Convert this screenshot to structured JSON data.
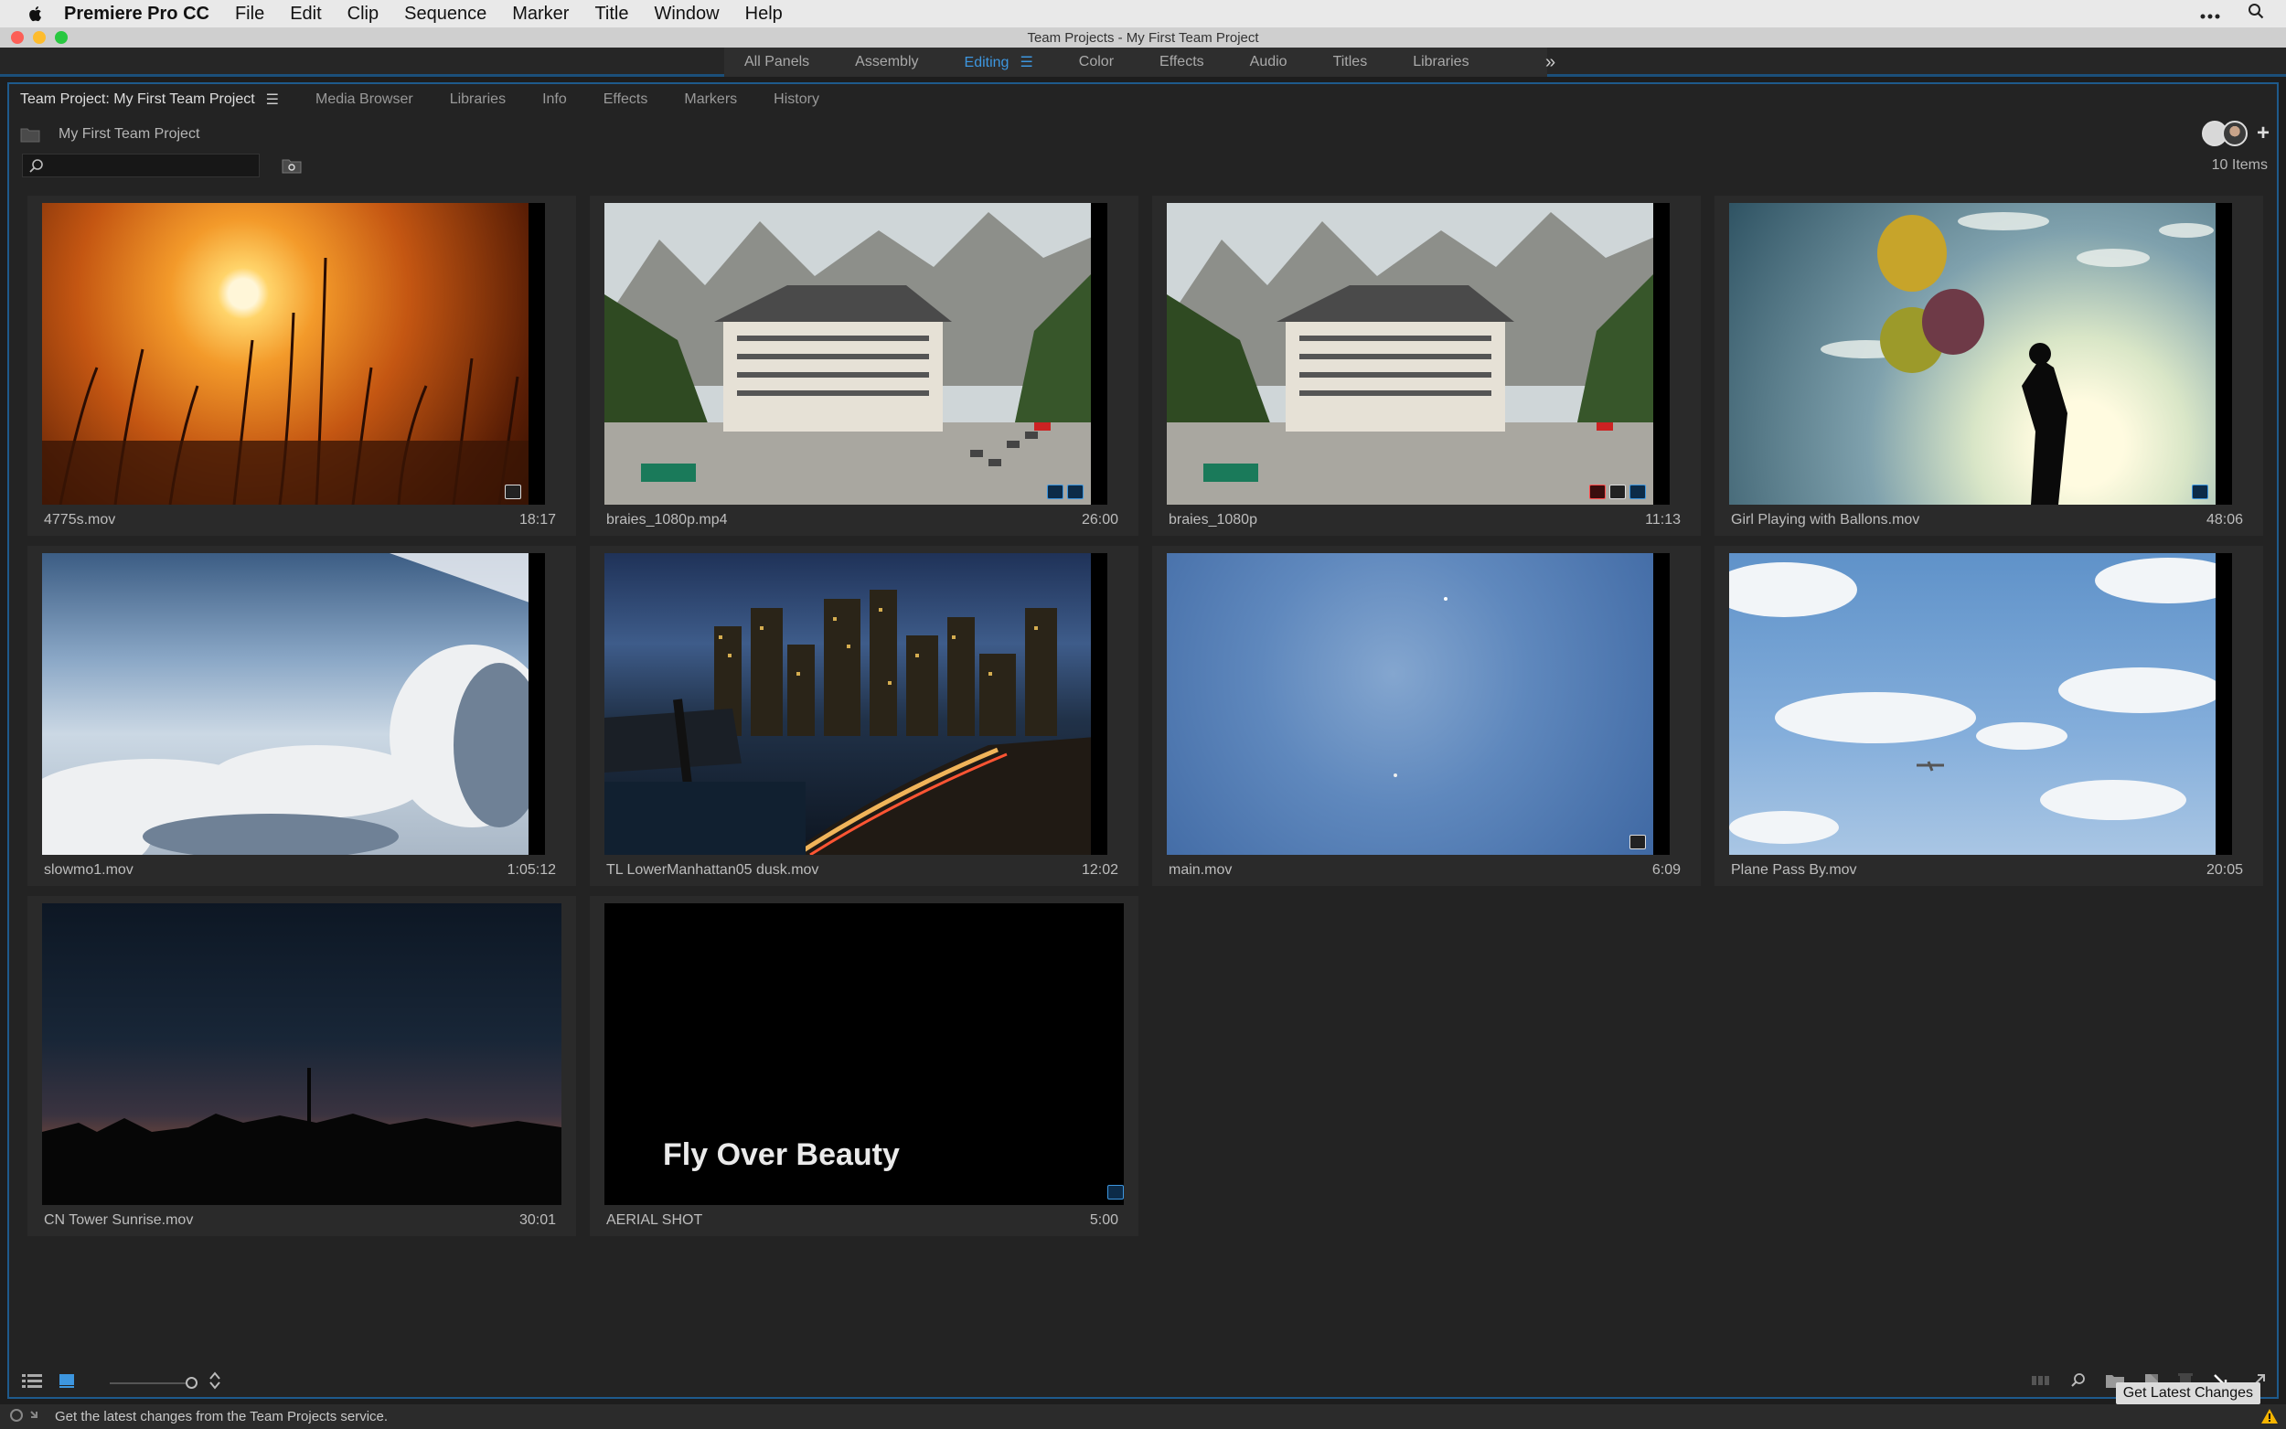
{
  "menubar": {
    "app_name": "Premiere Pro CC",
    "menus": [
      "File",
      "Edit",
      "Clip",
      "Sequence",
      "Marker",
      "Title",
      "Window",
      "Help"
    ]
  },
  "window": {
    "title": "Team Projects - My First Team Project"
  },
  "workspaces": {
    "items": [
      "All Panels",
      "Assembly",
      "Editing",
      "Color",
      "Effects",
      "Audio",
      "Titles",
      "Libraries"
    ],
    "active": "Editing"
  },
  "panel": {
    "tabs": [
      "Team Project: My First Team Project",
      "Media Browser",
      "Libraries",
      "Info",
      "Effects",
      "Markers",
      "History"
    ],
    "project_name": "My First Team Project",
    "search": {
      "value": "",
      "placeholder": ""
    },
    "item_count": "10 Items"
  },
  "clips": [
    {
      "name": "4775s.mov",
      "duration": "18:17"
    },
    {
      "name": "braies_1080p.mp4",
      "duration": "26:00"
    },
    {
      "name": "braies_1080p",
      "duration": "11:13"
    },
    {
      "name": "Girl Playing with Ballons.mov",
      "duration": "48:06"
    },
    {
      "name": "slowmo1.mov",
      "duration": "1:05:12"
    },
    {
      "name": "TL LowerManhattan05 dusk.mov",
      "duration": "12:02"
    },
    {
      "name": "main.mov",
      "duration": "6:09"
    },
    {
      "name": "Plane Pass By.mov",
      "duration": "20:05"
    },
    {
      "name": "CN Tower Sunrise.mov",
      "duration": "30:01"
    },
    {
      "name": "AERIAL SHOT",
      "duration": "5:00",
      "title_text": "Fly Over Beauty"
    }
  ],
  "bottom": {
    "tooltip": "Get Latest Changes",
    "status": "Get the latest changes from the Team Projects service."
  },
  "colors": {
    "accent": "#3d96df",
    "panel_border": "#1e5a8c"
  }
}
